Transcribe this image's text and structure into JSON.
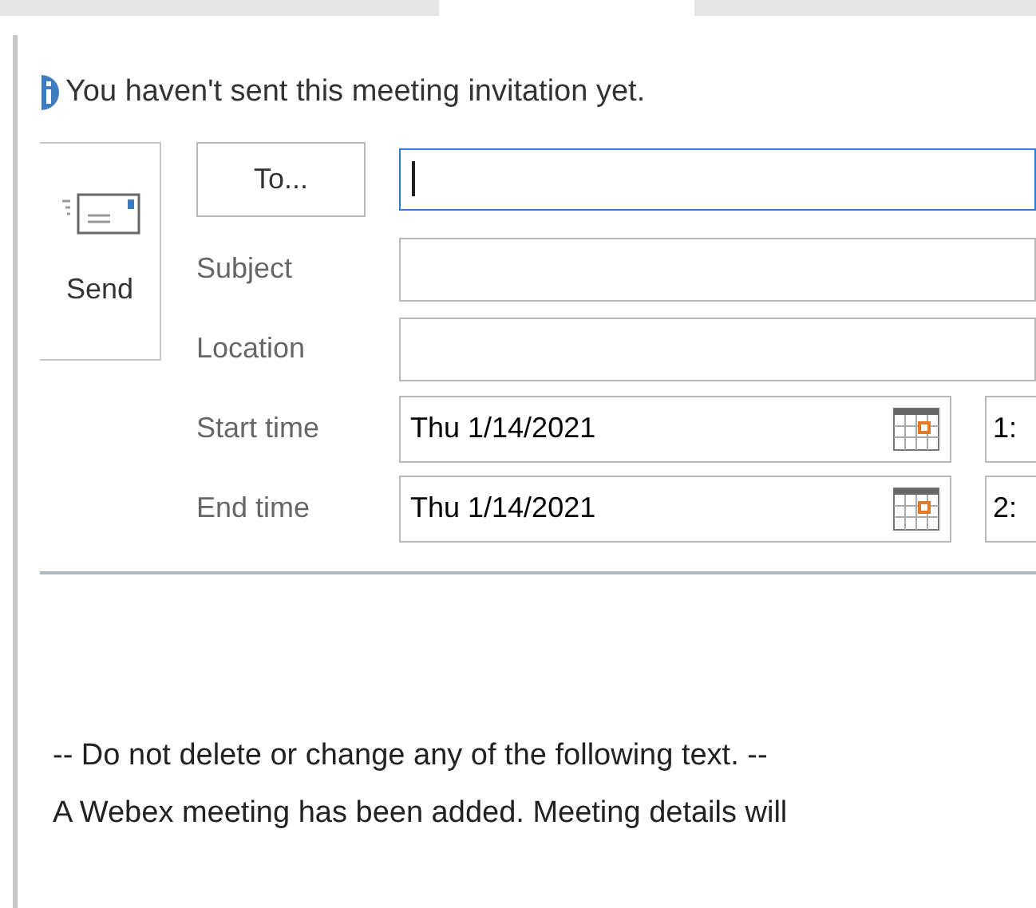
{
  "info_bar": {
    "text": "You haven't sent this meeting invitation yet."
  },
  "send_button": {
    "label": "Send"
  },
  "to_button": {
    "label": "To..."
  },
  "fields": [
    {
      "kind": "text",
      "label": "Subject"
    },
    {
      "kind": "text",
      "label": "Location"
    },
    {
      "kind": "datetime",
      "label": "Start time",
      "date": "Thu 1/14/2021",
      "time": "1:"
    },
    {
      "kind": "datetime",
      "label": "End time",
      "date": "Thu 1/14/2021",
      "time": "2:"
    }
  ],
  "body": [
    "-- Do not delete or change any of the following text. --",
    "A Webex meeting has been added. Meeting details will"
  ]
}
